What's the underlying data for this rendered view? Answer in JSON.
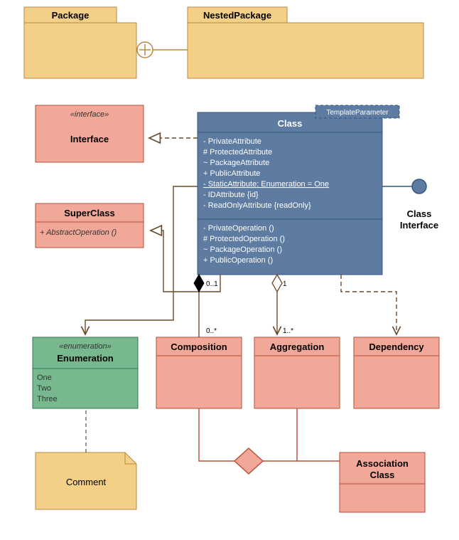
{
  "packages": {
    "package": {
      "title": "Package"
    },
    "nested": {
      "title": "NestedPackage"
    }
  },
  "interface": {
    "stereotype": "«interface»",
    "title": "Interface"
  },
  "superclass": {
    "title": "SuperClass",
    "operation": "+ AbstractOperation ()"
  },
  "enumeration": {
    "stereotype": "«enumeration»",
    "title": "Enumeration",
    "values": {
      "v1": "One",
      "v2": "Two",
      "v3": "Three"
    }
  },
  "comment": {
    "text": "Comment"
  },
  "class": {
    "template": "TemplateParameter",
    "title": "Class",
    "attrs": {
      "a1": "- PrivateAttribute",
      "a2": "# ProtectedAttribute",
      "a3": "~ PackageAttribute",
      "a4": "+ PublicAttribute",
      "a5": "- StaticAttribute: Enumeration = One",
      "a6": "- IDAttribute {id}",
      "a7": "- ReadOnlyAttribute {readOnly}"
    },
    "ops": {
      "o1": "- PrivateOperation ()",
      "o2": "# ProtectedOperation ()",
      "o3": "~ PackageOperation ()",
      "o4": "+ PublicOperation ()"
    }
  },
  "lollipop": {
    "line1": "Class",
    "line2": "Interface"
  },
  "composition": {
    "title": "Composition"
  },
  "aggregation": {
    "title": "Aggregation"
  },
  "dependency": {
    "title": "Dependency"
  },
  "association": {
    "title": "Association",
    "title2": "Class"
  },
  "multiplicities": {
    "m01": "0..1",
    "m1": "1",
    "m0s": "0..*",
    "m1s": "1..*"
  }
}
